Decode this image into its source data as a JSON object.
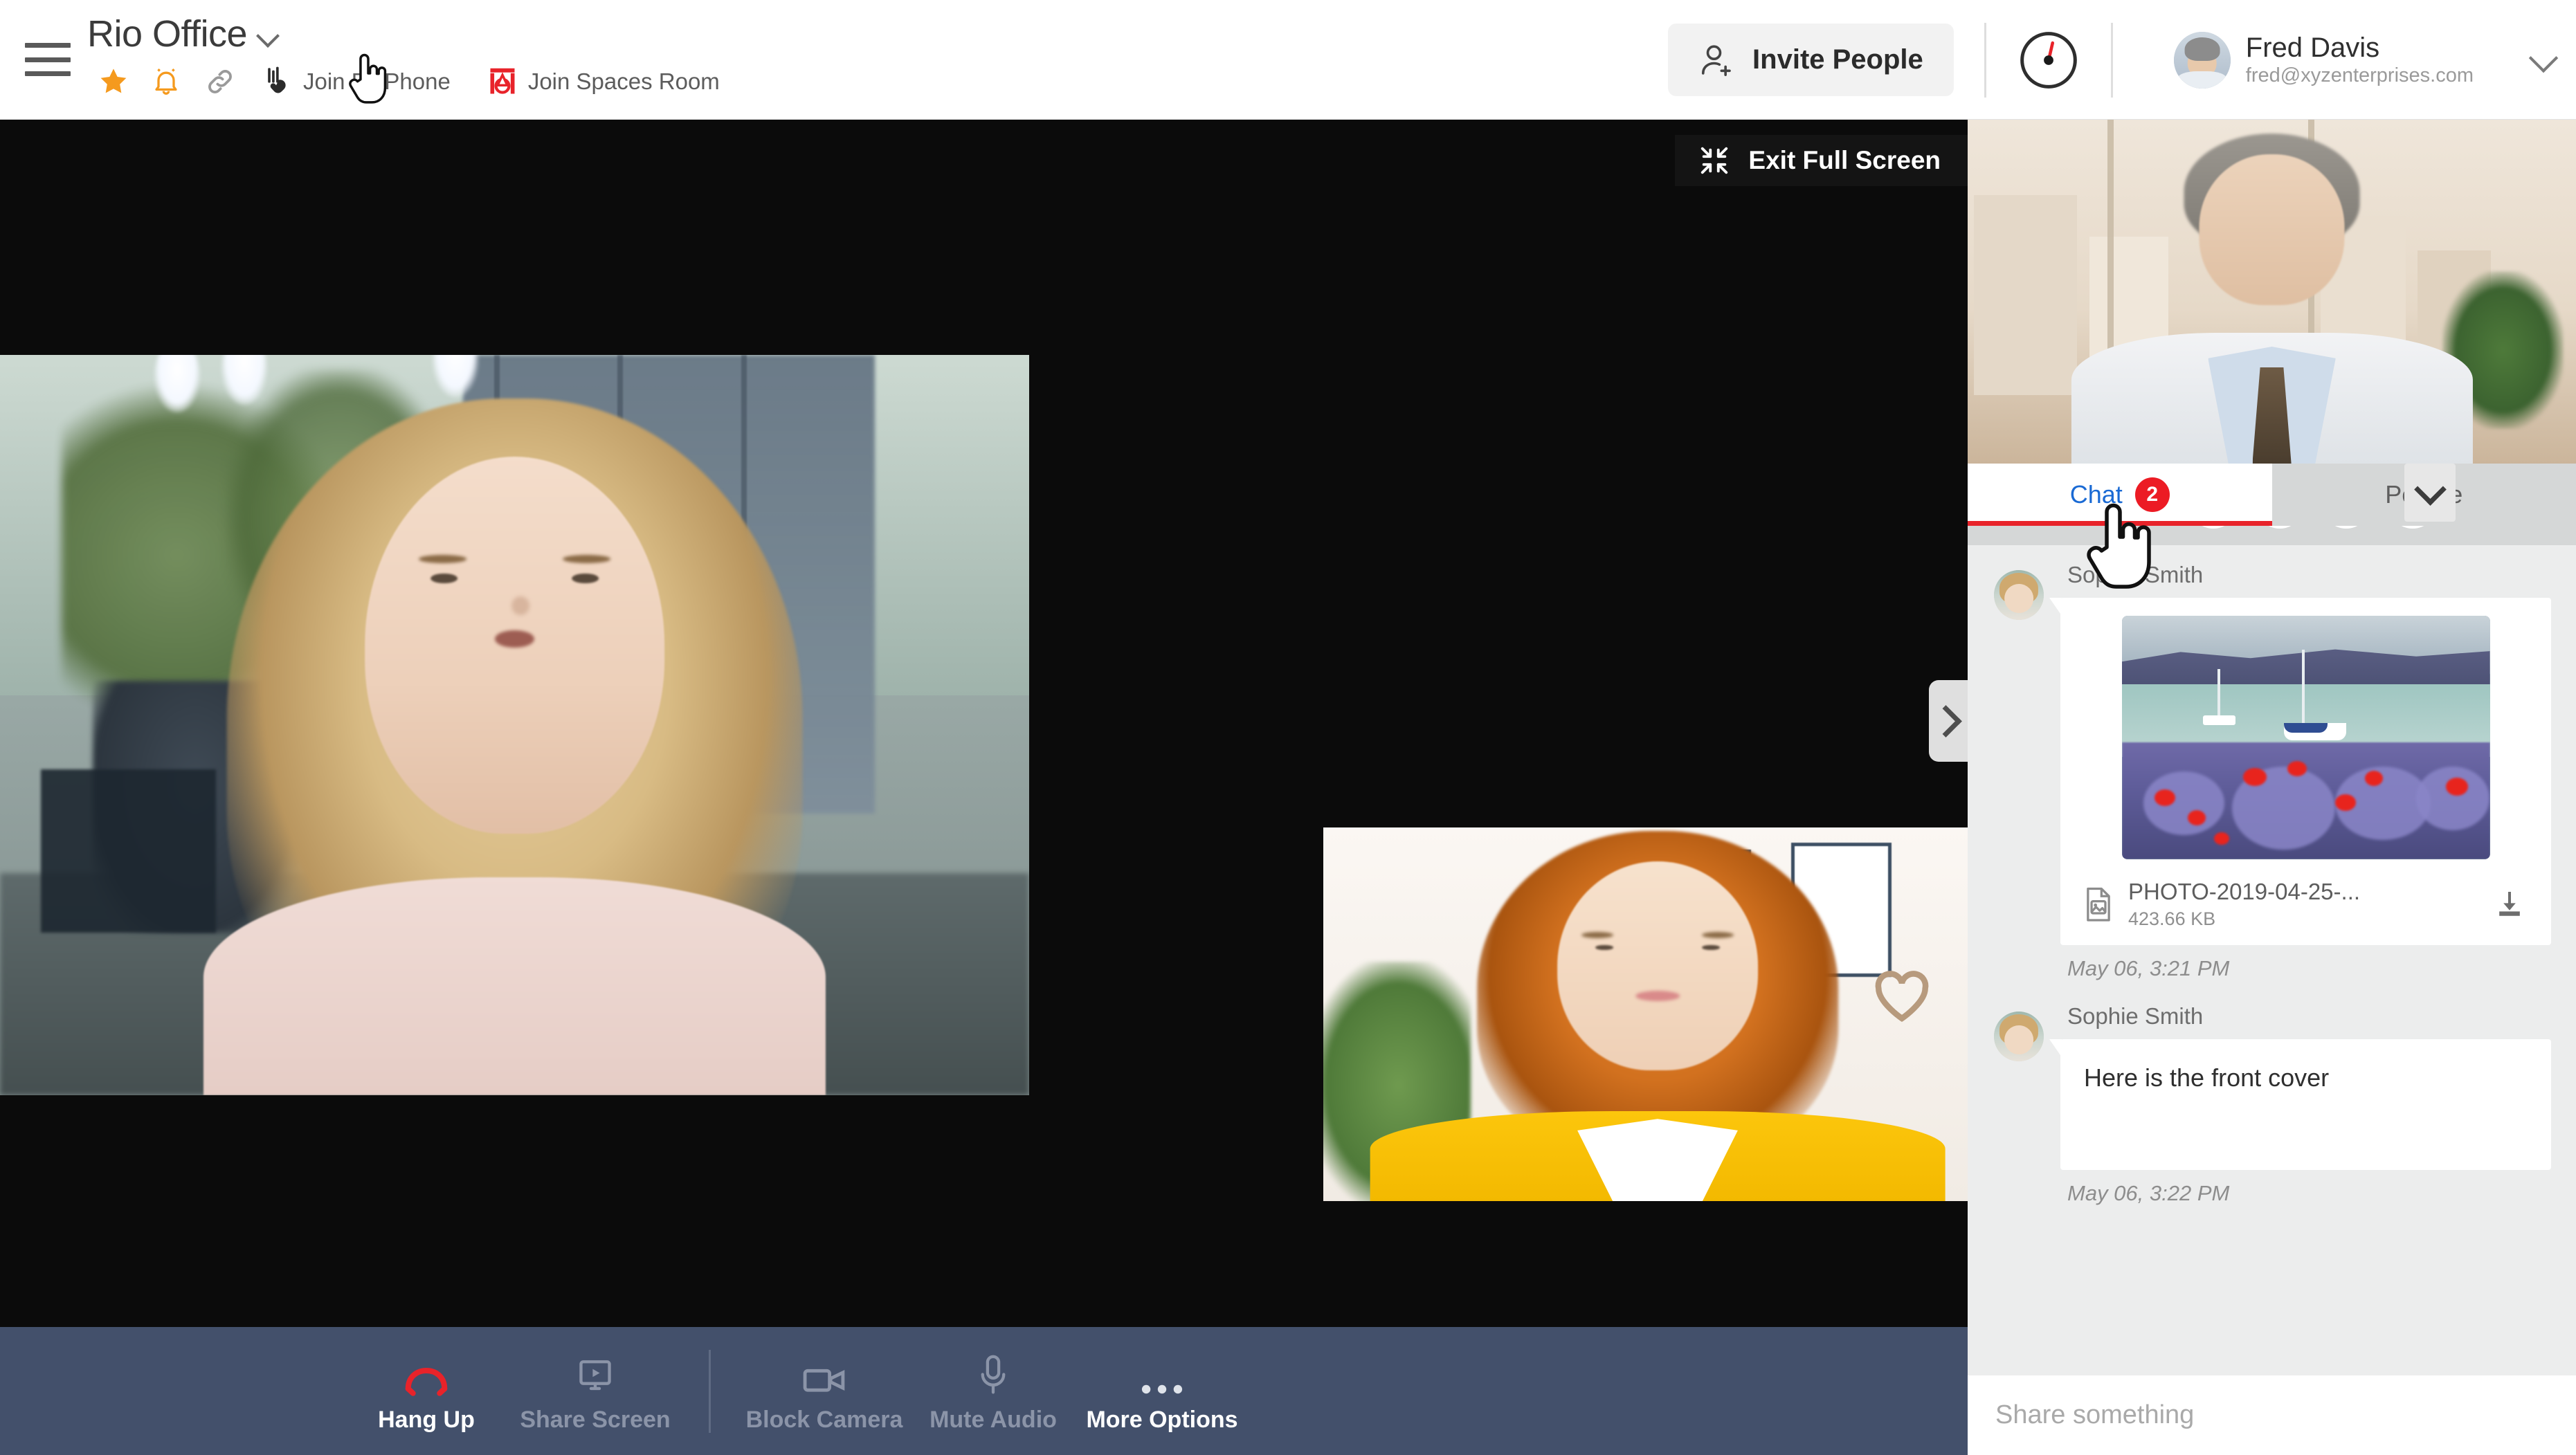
{
  "topbar": {
    "menu_icon": "hamburger-icon",
    "space_title": "Rio Office",
    "space_caret_icon": "chevron-down-icon",
    "actions": [
      {
        "icon": "star-icon",
        "label": ""
      },
      {
        "icon": "bell-icon",
        "label": ""
      },
      {
        "icon": "link-icon",
        "label": ""
      },
      {
        "icon": "phone-icon",
        "label": "Join By Phone"
      },
      {
        "icon": "spaces-room-icon",
        "label": "Join Spaces Room"
      }
    ],
    "invite_label": "Invite People",
    "invite_icon": "person-add-icon",
    "status_icon": "gauge-icon",
    "user": {
      "name": "Fred Davis",
      "email": "fred@xyzenterprises.com",
      "avatar_icon": "avatar",
      "caret_icon": "chevron-down-icon"
    }
  },
  "stage": {
    "exit_fullscreen_label": "Exit Full Screen",
    "exit_fullscreen_icon": "collapse-arrows-icon",
    "collapse_panel_icon": "chevron-right-icon",
    "main_tile_alt": "active speaker video",
    "pip_tile_alt": "participant video"
  },
  "call_toolbar": {
    "controls": [
      {
        "label": "Hang Up",
        "icon": "hangup-icon",
        "state": "on"
      },
      {
        "label": "Share Screen",
        "icon": "share-screen-icon",
        "state": "off"
      },
      {
        "label": "Block Camera",
        "icon": "camera-icon",
        "state": "off"
      },
      {
        "label": "Mute Audio",
        "icon": "microphone-icon",
        "state": "off"
      },
      {
        "label": "More Options",
        "icon": "more-dots-icon",
        "state": "on"
      }
    ]
  },
  "right_panel": {
    "selfview_alt": "self view video",
    "tabs": [
      {
        "label": "Chat",
        "badge": "2",
        "active": true
      },
      {
        "label": "People",
        "badge": "",
        "active": false
      }
    ],
    "tab_caret_icon": "chevron-down-icon",
    "messages": [
      {
        "author": "Sophie Smith",
        "type": "attachment",
        "file_name": "PHOTO-2019-04-25-...",
        "file_size": "423.66 KB",
        "file_icon": "image-file-icon",
        "download_icon": "download-icon",
        "timestamp": "May 06, 3:21 PM"
      },
      {
        "author": "Sophie Smith",
        "type": "text",
        "text": "Here is the front cover",
        "timestamp": "May 06, 3:22 PM"
      }
    ],
    "composer_placeholder": "Share something",
    "composer_value": ""
  },
  "colors": {
    "accent_blue": "#1a6ad4",
    "badge_red": "#ec1b24",
    "tab_underline": "#e8232a",
    "toolbar_slate": "#43506b",
    "star_orange": "#f59a1e",
    "panel_bg": "#eceded"
  }
}
